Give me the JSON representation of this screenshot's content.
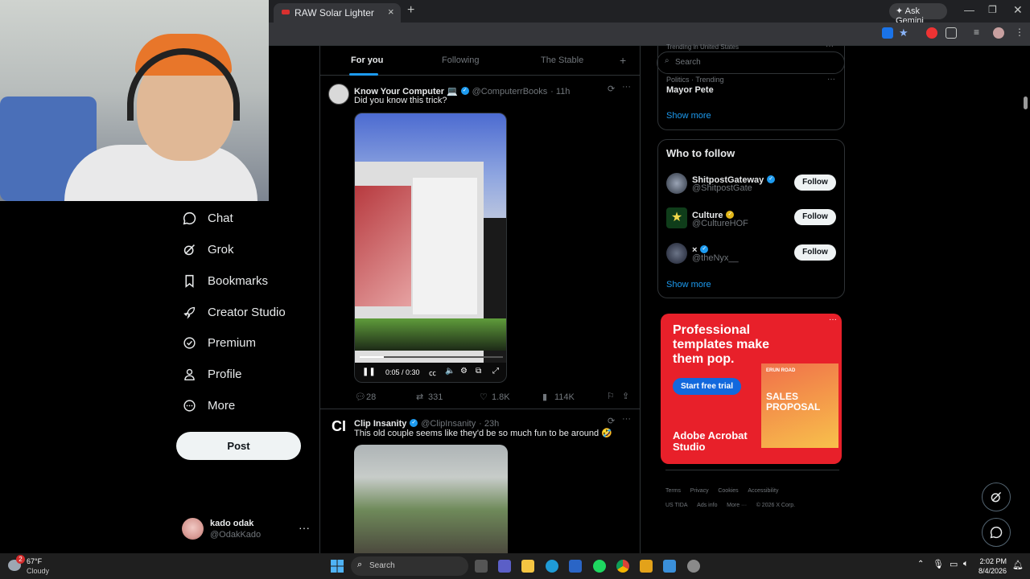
{
  "browser": {
    "tab_title": "RAW Solar Lighter",
    "tab_close": "×",
    "new_tab": "+",
    "gemini_label": "✦ Ask Gemini",
    "min": "—",
    "max": "❐",
    "close": "✕"
  },
  "nav": {
    "items": [
      {
        "label": "Chat",
        "icon": "chat-icon"
      },
      {
        "label": "Grok",
        "icon": "grok-icon"
      },
      {
        "label": "Bookmarks",
        "icon": "bookmark-icon"
      },
      {
        "label": "Creator Studio",
        "icon": "rocket-icon"
      },
      {
        "label": "Premium",
        "icon": "premium-icon"
      },
      {
        "label": "Profile",
        "icon": "profile-icon"
      },
      {
        "label": "More",
        "icon": "more-icon"
      }
    ],
    "post_label": "Post",
    "account": {
      "name": "kado odak",
      "handle": "@OdakKado",
      "more": "···"
    }
  },
  "feed": {
    "tabs": [
      "For you",
      "Following",
      "The Stable"
    ],
    "add_tab": "+",
    "posts": [
      {
        "name": "Know Your Computer 💻",
        "handle": "@ComputerrBooks",
        "time": "· 11h",
        "text": "Did you know this trick?",
        "video_time": "0:05 / 0:30",
        "video_progress": 0.167,
        "stats": {
          "replies": "28",
          "reposts": "331",
          "likes": "1.8K",
          "views": "114K"
        }
      },
      {
        "name": "Clip Insanity",
        "handle": "@ClipInsanity",
        "time": "· 23h",
        "text": "This old couple seems like they'd be so much fun to be around 🤣",
        "avatar_text": "CI"
      }
    ]
  },
  "right": {
    "search_placeholder": "Search",
    "trend_header": "Trending in United States",
    "trend": {
      "category": "Politics · Trending",
      "title": "Mayor Pete"
    },
    "show_more": "Show more",
    "who_to_follow": "Who to follow",
    "follow_label": "Follow",
    "suggestions": [
      {
        "name": "ShitpostGateway",
        "handle": "@ShitpostGate",
        "badge": "blue"
      },
      {
        "name": "Culture",
        "handle": "@CultureHOF",
        "badge": "gold"
      },
      {
        "name": "×",
        "handle": "@theNyx__",
        "badge": "blue"
      }
    ],
    "ad": {
      "headline": "Professional templates make them pop.",
      "cta": "Start free trial",
      "brand": "Adobe Acrobat Studio",
      "doc_title": "SALES PROPOSAL",
      "doc_brand": "ERUN ROAD"
    },
    "footer": [
      "Terms",
      "Privacy",
      "Cookies",
      "Accessibility",
      "US TIDA",
      "Ads info",
      "More ···",
      "© 2026 X Corp."
    ]
  },
  "taskbar": {
    "weather_temp": "67°F",
    "weather_desc": "Cloudy",
    "weather_badge": "2",
    "search": "Search",
    "time": "2:02 PM",
    "date": "8/4/2026"
  },
  "colors": {
    "accent": "#1d9bf0",
    "ad_red": "#e8202a",
    "bg": "#000000"
  }
}
